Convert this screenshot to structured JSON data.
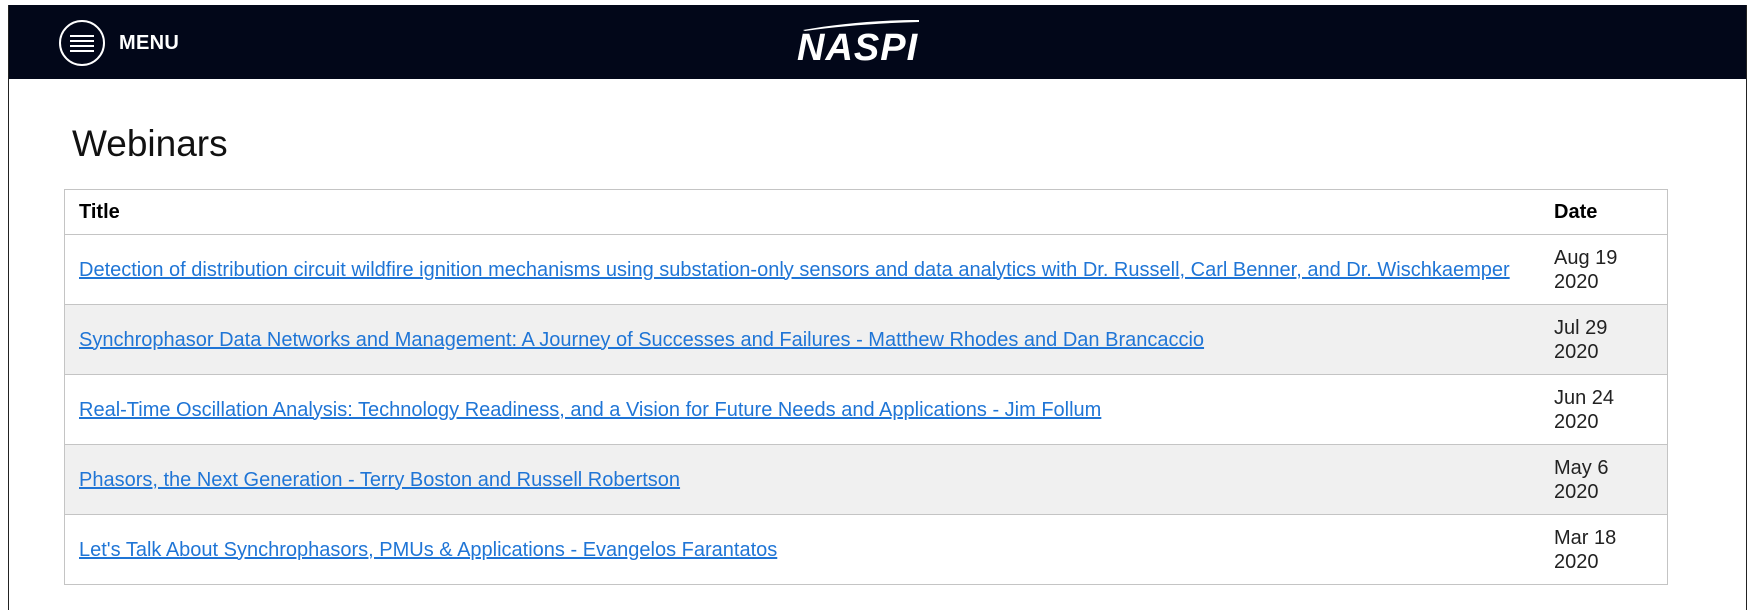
{
  "header": {
    "menu_label": "MENU",
    "logo_text": "NASPI",
    "colors": {
      "bar": "#020719",
      "text": "#ffffff"
    }
  },
  "page": {
    "title": "Webinars"
  },
  "table": {
    "columns": [
      "Title",
      "Date"
    ],
    "rows": [
      {
        "title": "Detection of distribution circuit wildfire ignition mechanisms using substation-only sensors and data analytics with Dr. Russell, Carl Benner, and Dr. Wischkaemper",
        "date_line1": "Aug 19",
        "date_line2": "2020"
      },
      {
        "title": "Synchrophasor Data Networks and Management: A Journey of Successes and Failures - Matthew Rhodes and Dan Brancaccio",
        "date_line1": "Jul 29",
        "date_line2": "2020"
      },
      {
        "title": "Real-Time Oscillation Analysis: Technology Readiness, and a Vision for Future Needs and Applications - Jim Follum",
        "date_line1": "Jun 24",
        "date_line2": "2020"
      },
      {
        "title": "Phasors, the Next Generation - Terry Boston and Russell Robertson",
        "date_line1": "May 6",
        "date_line2": "2020"
      },
      {
        "title": "Let's Talk About Synchrophasors, PMUs & Applications - Evangelos Farantatos",
        "date_line1": "Mar 18",
        "date_line2": "2020"
      }
    ],
    "colors": {
      "link": "#1f75d6",
      "stripe": "#f0f0f0",
      "border": "#c4c4c4"
    }
  },
  "icons": {
    "menu": "hamburger-circle-icon"
  }
}
